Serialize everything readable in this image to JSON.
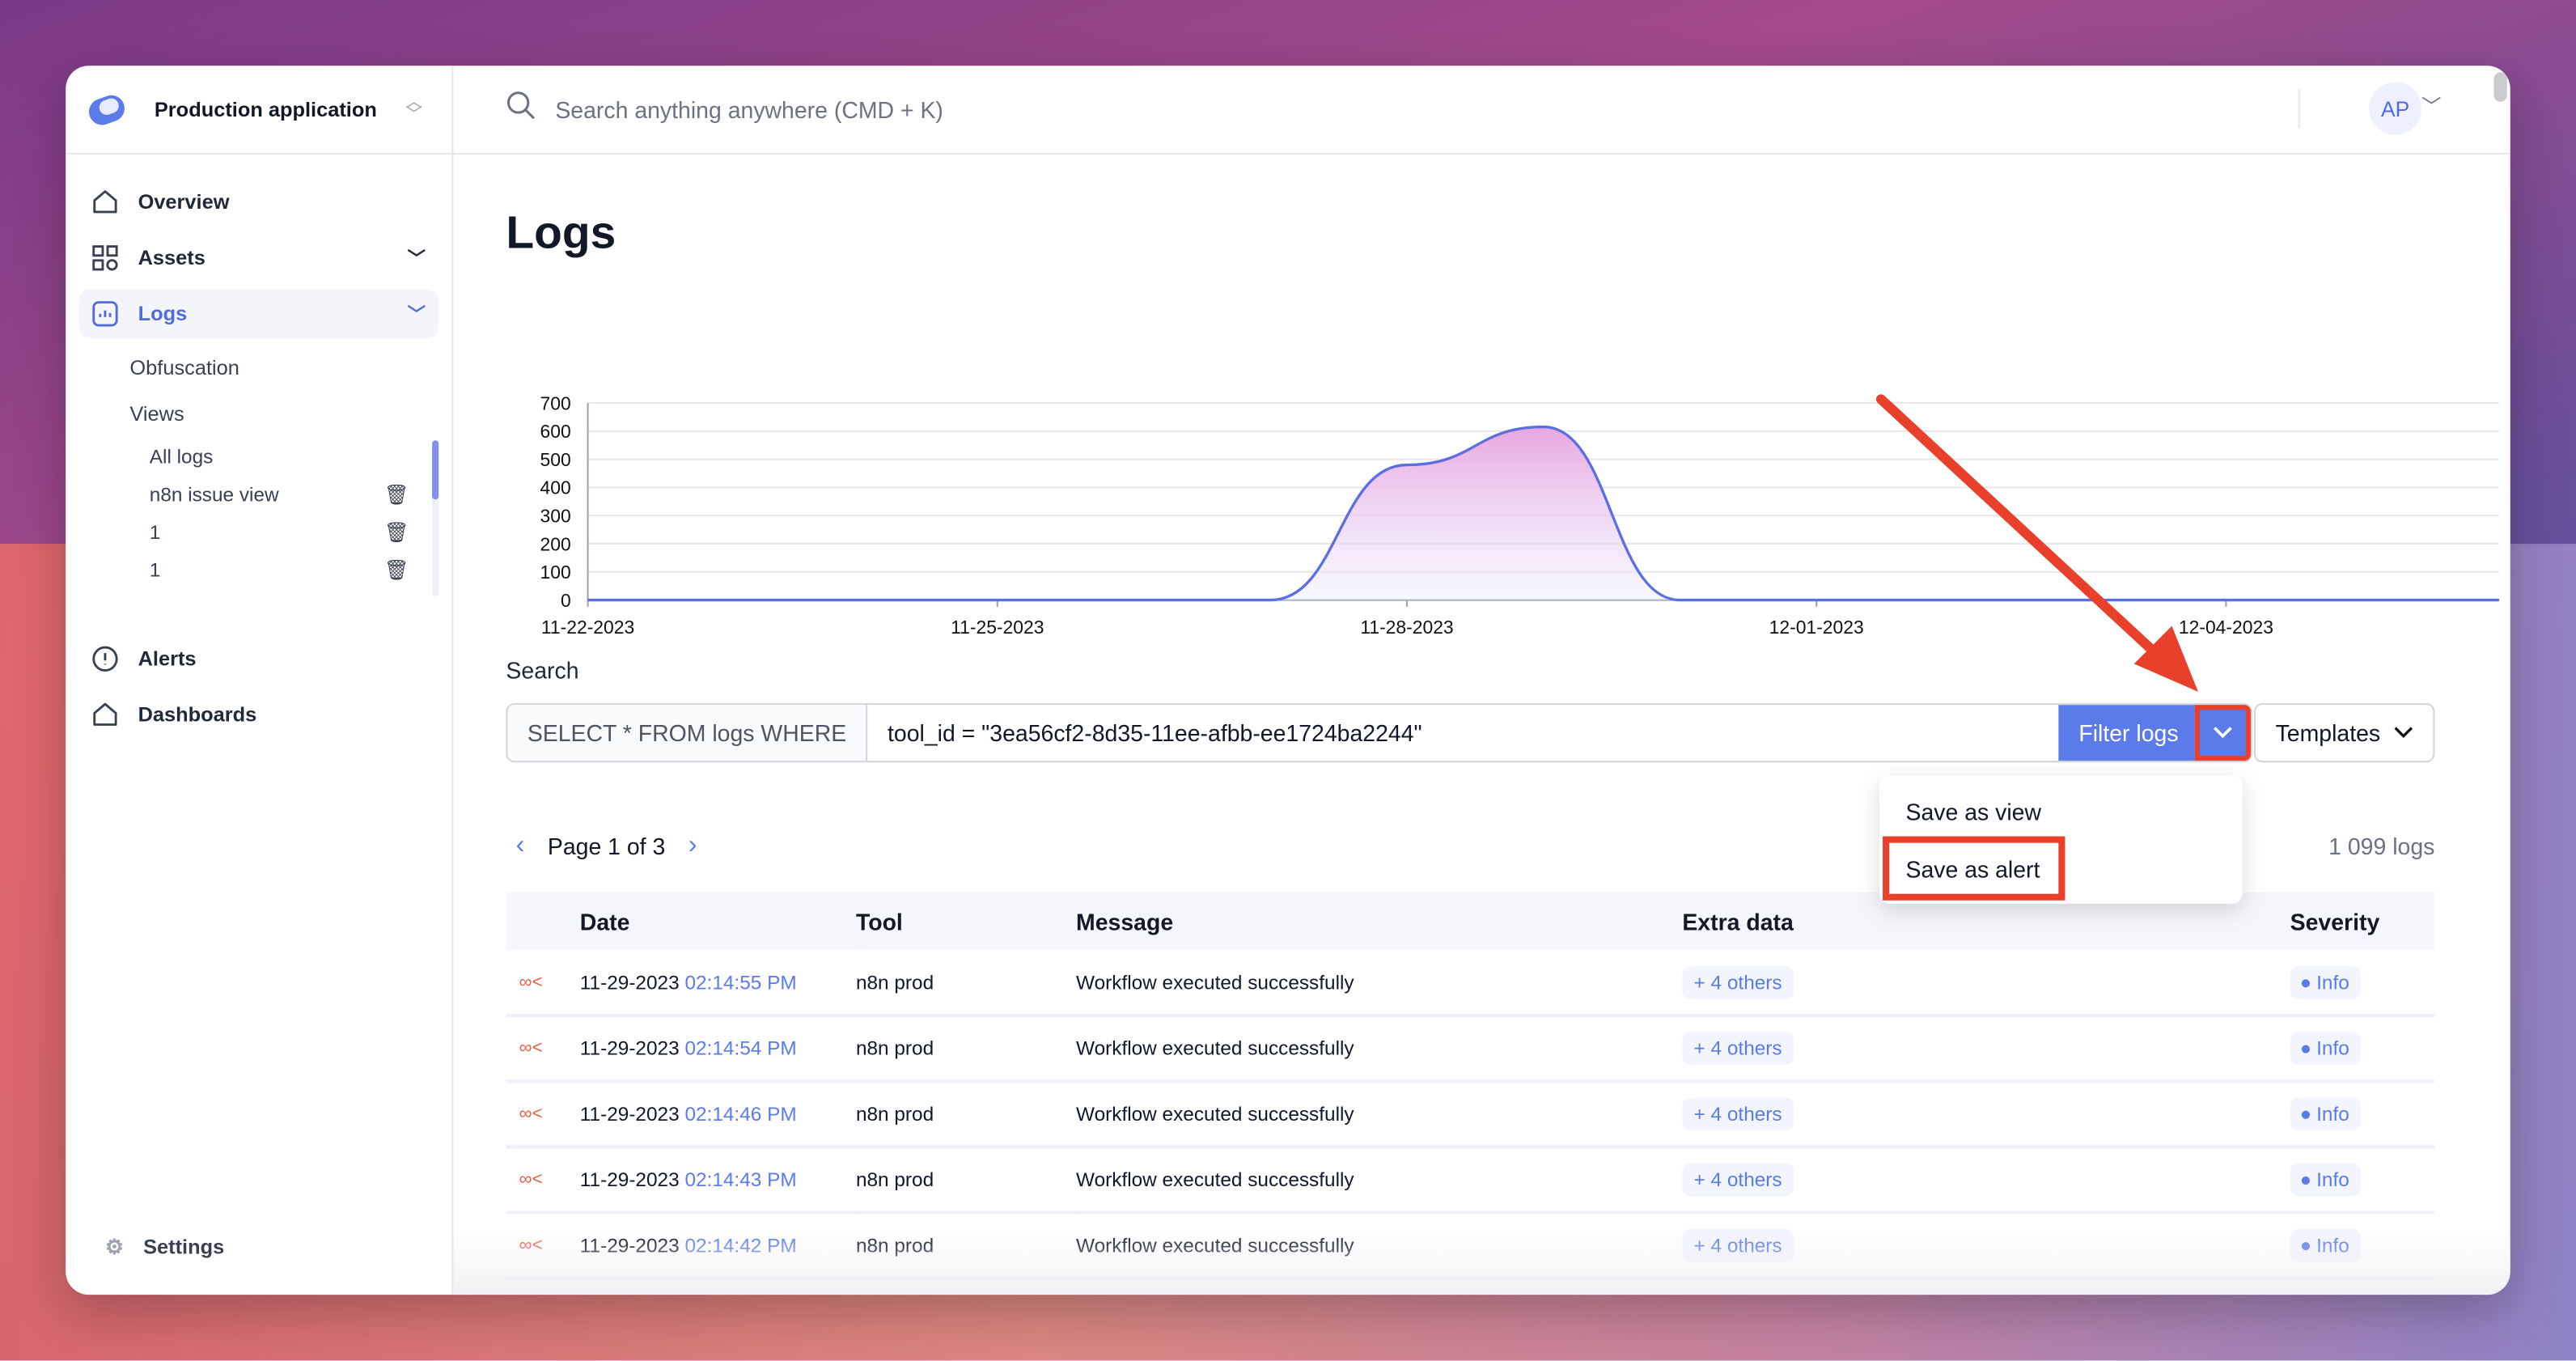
{
  "app": {
    "name": "Production application"
  },
  "sidebar": {
    "items": [
      {
        "label": "Overview",
        "icon": "home-icon"
      },
      {
        "label": "Assets",
        "icon": "grid-icon"
      },
      {
        "label": "Logs",
        "icon": "chart-icon",
        "active": true
      },
      {
        "label": "Alerts",
        "icon": "alert-circle-icon"
      },
      {
        "label": "Dashboards",
        "icon": "home-icon"
      }
    ],
    "logs_sub": {
      "obfuscation": "Obfuscation",
      "views": "Views",
      "view_items": [
        "All logs",
        "n8n issue view",
        "1",
        "1"
      ]
    },
    "settings": "Settings"
  },
  "topbar": {
    "search_placeholder": "Search anything anywhere (CMD + K)",
    "avatar": "AP"
  },
  "page": {
    "title": "Logs",
    "search_label": "Search",
    "query_prefix": "SELECT * FROM logs WHERE",
    "query_value": "tool_id = \"3ea56cf2-8d35-11ee-afbb-ee1724ba2244\"",
    "filter_button": "Filter logs",
    "templates_button": "Templates",
    "pager": "Page 1 of 3",
    "log_count": "1 099 logs"
  },
  "dropdown": {
    "items": [
      "Save as view",
      "Save as alert"
    ],
    "highlighted": "Save as alert"
  },
  "accent": "#5b7bea",
  "annotation_color": "#e8402a",
  "table": {
    "columns": [
      "Date",
      "Tool",
      "Message",
      "Extra data",
      "Severity"
    ],
    "rows": [
      {
        "date": "11-29-2023",
        "time": "02:14:55 PM",
        "tool": "n8n prod",
        "message": "Workflow executed successfully",
        "extra": "+ 4 others",
        "severity": "Info"
      },
      {
        "date": "11-29-2023",
        "time": "02:14:54 PM",
        "tool": "n8n prod",
        "message": "Workflow executed successfully",
        "extra": "+ 4 others",
        "severity": "Info"
      },
      {
        "date": "11-29-2023",
        "time": "02:14:46 PM",
        "tool": "n8n prod",
        "message": "Workflow executed successfully",
        "extra": "+ 4 others",
        "severity": "Info"
      },
      {
        "date": "11-29-2023",
        "time": "02:14:43 PM",
        "tool": "n8n prod",
        "message": "Workflow executed successfully",
        "extra": "+ 4 others",
        "severity": "Info"
      },
      {
        "date": "11-29-2023",
        "time": "02:14:42 PM",
        "tool": "n8n prod",
        "message": "Workflow executed successfully",
        "extra": "+ 4 others",
        "severity": "Info"
      }
    ]
  },
  "chart_data": {
    "type": "area",
    "grid": true,
    "ylim": [
      0,
      700
    ],
    "yticks": [
      "0",
      "100",
      "200",
      "300",
      "400",
      "500",
      "600",
      "700"
    ],
    "xticks": [
      "11-22-2023",
      "11-25-2023",
      "11-28-2023",
      "12-01-2023",
      "12-04-2023"
    ],
    "x": [
      "11-22",
      "11-23",
      "11-24",
      "11-25",
      "11-26",
      "11-27",
      "11-28",
      "11-29",
      "11-30",
      "12-01",
      "12-02",
      "12-03",
      "12-04",
      "12-05",
      "12-06"
    ],
    "values": [
      0,
      0,
      0,
      0,
      0,
      0,
      480,
      615,
      0,
      0,
      0,
      0,
      0,
      0,
      0
    ]
  }
}
